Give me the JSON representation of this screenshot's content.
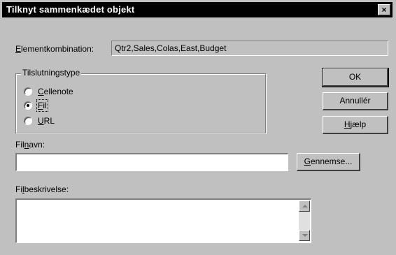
{
  "window": {
    "title": "Tilknyt sammenkædet objekt",
    "close_glyph": "×"
  },
  "member_combination": {
    "label": "Elementkombination:",
    "value": "Qtr2,Sales,Colas,East,Budget"
  },
  "connection_type": {
    "title": "Tilslutningstype",
    "options": [
      {
        "label": "Cellenote",
        "selected": false
      },
      {
        "label": "Fil",
        "selected": true
      },
      {
        "label": "URL",
        "selected": false
      }
    ]
  },
  "buttons": {
    "ok": "OK",
    "cancel": "Annullér",
    "help": "Hjælp",
    "browse": "Gennemse..."
  },
  "file_name": {
    "label": "Filnavn:",
    "value": ""
  },
  "file_description": {
    "label": "Filbeskrivelse:",
    "value": ""
  }
}
